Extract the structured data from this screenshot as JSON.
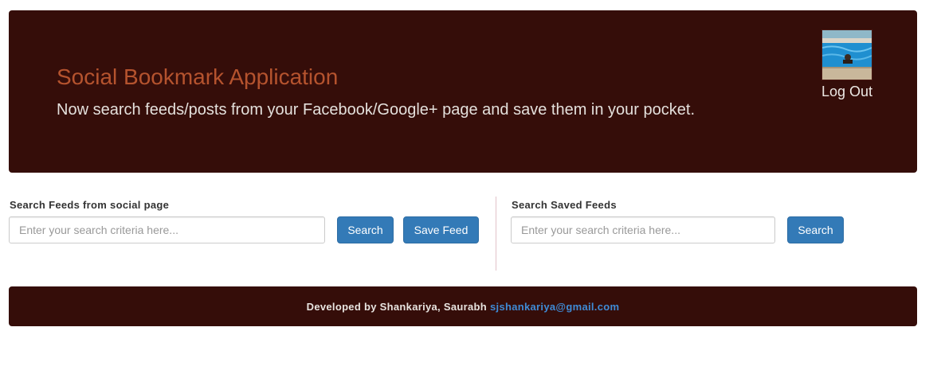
{
  "header": {
    "title": "Social Bookmark Application",
    "tagline": "Now search feeds/posts from your Facebook/Google+ page and save them in your pocket.",
    "logout_label": "Log Out",
    "avatar_icon": "user-avatar-pool-photo"
  },
  "social_search": {
    "label": "Search Feeds from social page",
    "placeholder": "Enter your search criteria here...",
    "value": "",
    "search_button": "Search",
    "save_button": "Save Feed"
  },
  "saved_search": {
    "label": "Search Saved Feeds",
    "placeholder": "Enter your search criteria here...",
    "value": "",
    "search_button": "Search"
  },
  "footer": {
    "text": "Developed by Shankariya, Saurabh",
    "email": "sjshankariya@gmail.com"
  },
  "colors": {
    "banner_bg": "#350d09",
    "title_color": "#b5532e",
    "button_bg": "#337ab7",
    "link_color": "#3f8bd6"
  }
}
